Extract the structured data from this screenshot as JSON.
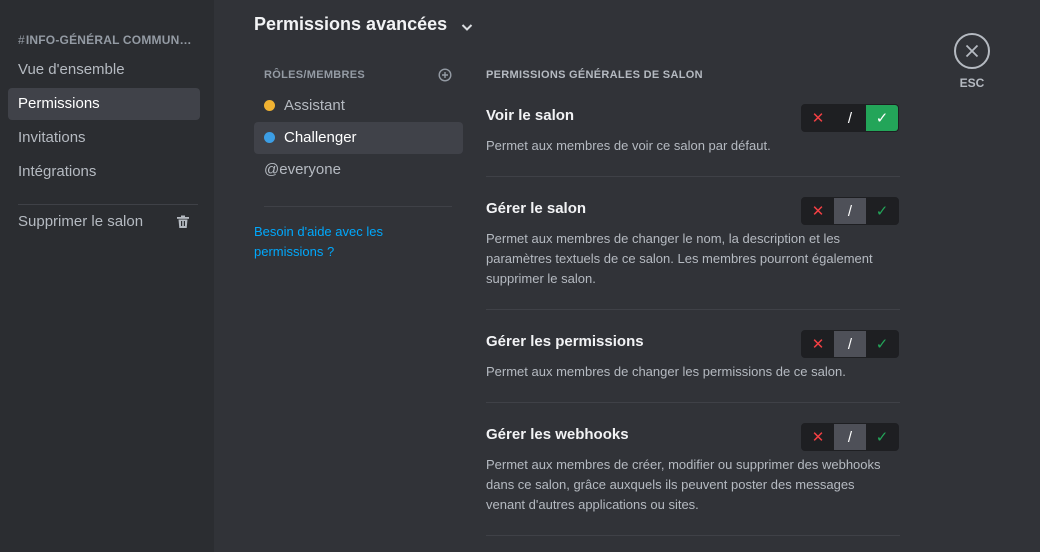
{
  "sidebar": {
    "channel_header": "INFO-GÉNÉRAL COMMUN…",
    "items": [
      {
        "label": "Vue d'ensemble"
      },
      {
        "label": "Permissions"
      },
      {
        "label": "Invitations"
      },
      {
        "label": "Intégrations"
      }
    ],
    "delete_label": "Supprimer le salon"
  },
  "header": {
    "title": "Permissions avancées"
  },
  "roles": {
    "heading": "RÔLES/MEMBRES",
    "items": [
      {
        "label": "Assistant",
        "color": "#f0b232"
      },
      {
        "label": "Challenger",
        "color": "#3c9ee5"
      },
      {
        "label": "@everyone"
      }
    ],
    "help_link": "Besoin d'aide avec les permissions ?"
  },
  "permissions": {
    "heading": "PERMISSIONS GÉNÉRALES DE SALON",
    "items": [
      {
        "title": "Voir le salon",
        "description": "Permet aux membres de voir ce salon par défaut.",
        "state": "allow"
      },
      {
        "title": "Gérer le salon",
        "description": "Permet aux membres de changer le nom, la description et les paramètres textuels de ce salon. Les membres pourront également supprimer le salon.",
        "state": "neutral"
      },
      {
        "title": "Gérer les permissions",
        "description": "Permet aux membres de changer les permissions de ce salon.",
        "state": "neutral"
      },
      {
        "title": "Gérer les webhooks",
        "description": "Permet aux membres de créer, modifier ou supprimer des webhooks dans ce salon, grâce auxquels ils peuvent poster des messages venant d'autres applications ou sites.",
        "state": "neutral"
      }
    ],
    "toggle_glyphs": {
      "deny": "✕",
      "neutral": "/",
      "allow": "✓"
    }
  },
  "close": {
    "label": "ESC"
  },
  "colors": {
    "accent": "#23a559",
    "deny": "#f23f43",
    "link": "#00a8fc"
  }
}
